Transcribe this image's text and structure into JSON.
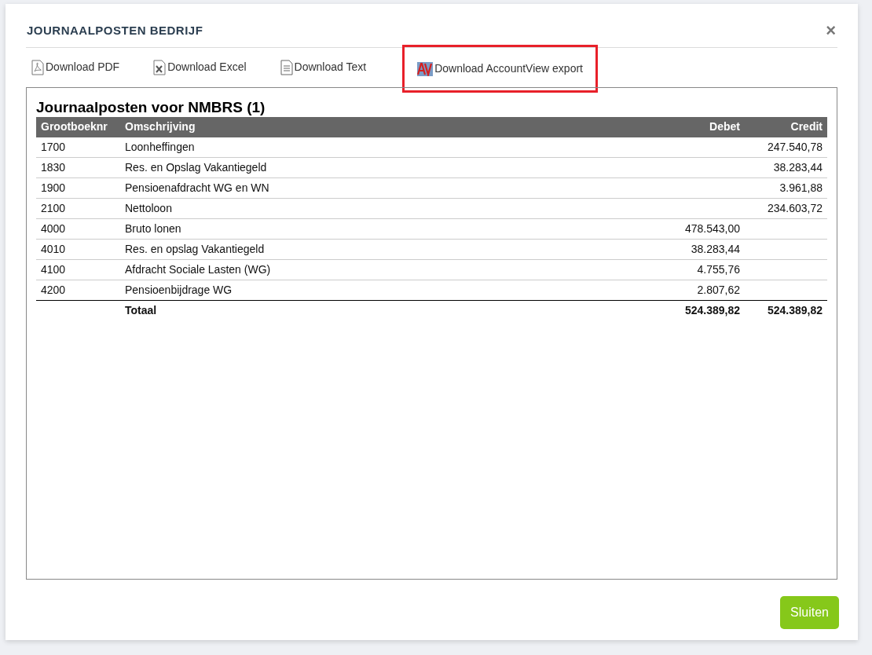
{
  "dialog": {
    "title": "JOURNAALPOSTEN BEDRIJF",
    "close": "×"
  },
  "downloads": [
    {
      "kind": "pdf",
      "label": "Download PDF",
      "highlighted": false
    },
    {
      "kind": "excel",
      "label": "Download Excel",
      "highlighted": false
    },
    {
      "kind": "text",
      "label": "Download Text",
      "highlighted": false
    },
    {
      "kind": "accountview",
      "label": "Download AccountView export",
      "highlighted": true
    }
  ],
  "report": {
    "title": "Journaalposten voor NMBRS (1)",
    "columns": [
      "Grootboeknr",
      "Omschrijving",
      "Debet",
      "Credit"
    ],
    "rows": [
      {
        "account": "1700",
        "description": "Loonheffingen",
        "debit": "",
        "credit": "247.540,78"
      },
      {
        "account": "1830",
        "description": "Res. en Opslag Vakantiegeld",
        "debit": "",
        "credit": "38.283,44"
      },
      {
        "account": "1900",
        "description": "Pensioenafdracht WG en WN",
        "debit": "",
        "credit": "3.961,88"
      },
      {
        "account": "2100",
        "description": "Nettoloon",
        "debit": "",
        "credit": "234.603,72"
      },
      {
        "account": "4000",
        "description": "Bruto lonen",
        "debit": "478.543,00",
        "credit": ""
      },
      {
        "account": "4010",
        "description": "Res. en opslag Vakantiegeld",
        "debit": "38.283,44",
        "credit": ""
      },
      {
        "account": "4100",
        "description": "Afdracht Sociale Lasten (WG)",
        "debit": "4.755,76",
        "credit": ""
      },
      {
        "account": "4200",
        "description": "Pensioenbijdrage WG",
        "debit": "2.807,62",
        "credit": ""
      }
    ],
    "total": {
      "label": "Totaal",
      "debit": "524.389,82",
      "credit": "524.389,82"
    }
  },
  "footer": {
    "button": "Sluiten"
  }
}
